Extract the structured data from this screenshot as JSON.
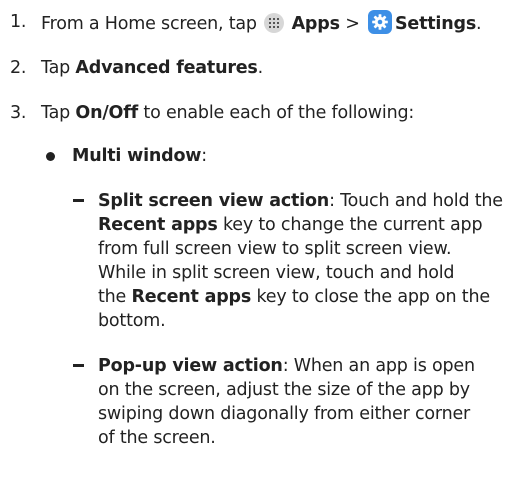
{
  "steps": [
    {
      "number": "1.",
      "prefix": "From a Home screen, tap",
      "apps": "Apps",
      "separator": ">",
      "settings": "Settings",
      "end": "."
    },
    {
      "number": "2.",
      "prefix": "Tap",
      "target": "Advanced features",
      "end": "."
    },
    {
      "number": "3.",
      "prefix": "Tap",
      "target": "On/Off",
      "rest": "to enable each of the following:"
    }
  ],
  "bullet": {
    "label": "Multi window",
    "colon": ":"
  },
  "sub_items": [
    {
      "label": "Split screen view action",
      "lines": {
        "l1": ": Touch and hold the",
        "l2_bold": "Recent apps",
        "l2": "key to change the current app",
        "l3": "from full screen view to split screen view.",
        "l4": "While in split screen view, touch and hold",
        "l5_pre": "the",
        "l5_bold": "Recent apps",
        "l5": "key to close the app on the",
        "l6": "bottom."
      }
    },
    {
      "label": "Pop-up view action",
      "lines": {
        "l1": ": When an app is open",
        "l2": "on the screen, adjust the size of the app by",
        "l3": "swiping down diagonally from either corner",
        "l4": "of the screen."
      }
    }
  ],
  "icons": {
    "apps_icon": "apps-grid-icon",
    "settings_icon": "settings-gear-icon",
    "settings_color": "#3d8fe6"
  }
}
